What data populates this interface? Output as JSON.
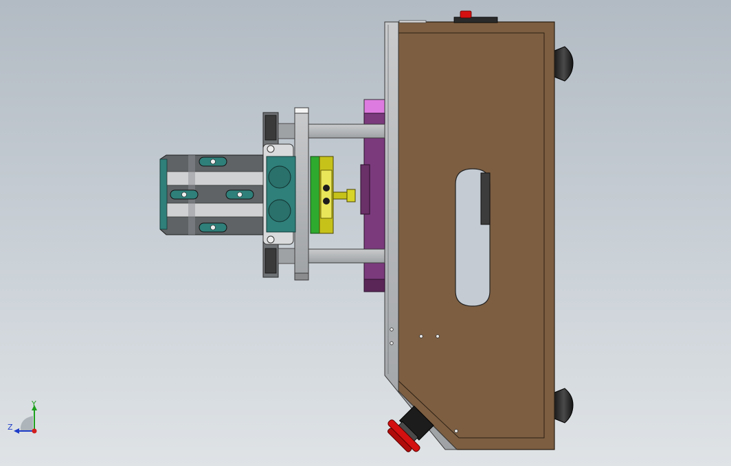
{
  "triad": {
    "y_label": "Y",
    "z_label": "Z",
    "x_color": "#d21e1e",
    "y_color": "#1ea01e",
    "z_color": "#1e3cc8"
  },
  "colors": {
    "box_wood": "#7d5e41",
    "frame_steel": "#b4b6b8",
    "block_purple": "#7a3a7c",
    "block_pink": "#de7be0",
    "slide_teal": "#2f7f7a",
    "bracket_yellow": "#c6c21a",
    "bracket_green": "#2eaa2e",
    "button_red": "#d41010",
    "black": "#1c1c1c"
  }
}
